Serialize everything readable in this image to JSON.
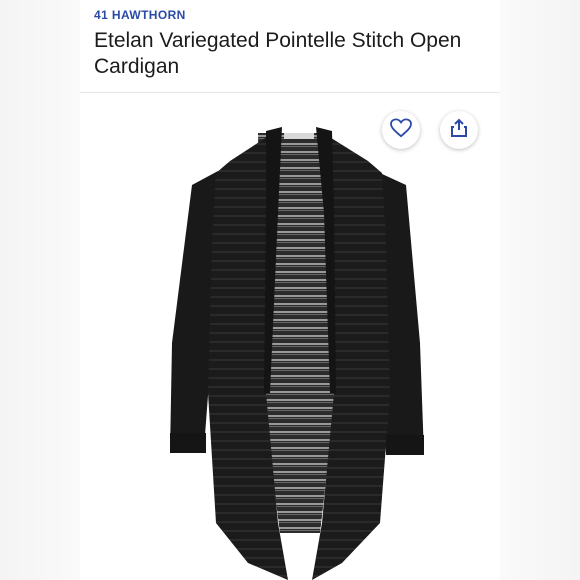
{
  "product": {
    "brand": "41 HAWTHORN",
    "title": "Etelan Variegated Pointelle Stitch Open Cardigan"
  },
  "icons": {
    "favorite": "heart-outline-icon",
    "share": "share-upload-icon"
  },
  "colors": {
    "brand": "#2a4aa6",
    "garment": "#1b1b1b"
  }
}
